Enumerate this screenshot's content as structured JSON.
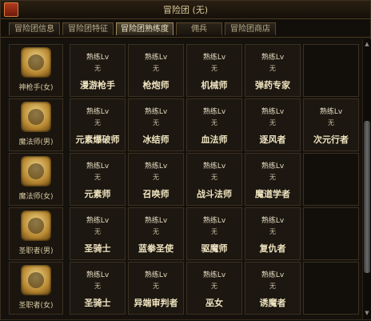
{
  "window": {
    "title": "冒险团 (无)"
  },
  "tabs": [
    {
      "label": "冒险团信息",
      "active": false
    },
    {
      "label": "冒险团特征",
      "active": false
    },
    {
      "label": "冒险团熟练度",
      "active": true
    },
    {
      "label": "佣兵",
      "active": false
    },
    {
      "label": "冒险团商店",
      "active": false
    }
  ],
  "help_icon": "?",
  "proficiency_label": "熟练Lv",
  "proficiency_value": "无",
  "rows": [
    {
      "character": "神枪手(女)",
      "jobs": [
        "漫游枪手",
        "枪炮师",
        "机械师",
        "弹药专家"
      ]
    },
    {
      "character": "魔法师(男)",
      "jobs": [
        "元素爆破师",
        "冰结师",
        "血法师",
        "逐风者",
        "次元行者"
      ]
    },
    {
      "character": "魔法师(女)",
      "jobs": [
        "元素师",
        "召唤师",
        "战斗法师",
        "魔道学者"
      ]
    },
    {
      "character": "圣职者(男)",
      "jobs": [
        "圣骑士",
        "蓝拳圣使",
        "驱魔师",
        "复仇者"
      ]
    },
    {
      "character": "圣职者(女)",
      "jobs": [
        "圣骑士",
        "异端审判者",
        "巫女",
        "诱魔者"
      ]
    }
  ]
}
